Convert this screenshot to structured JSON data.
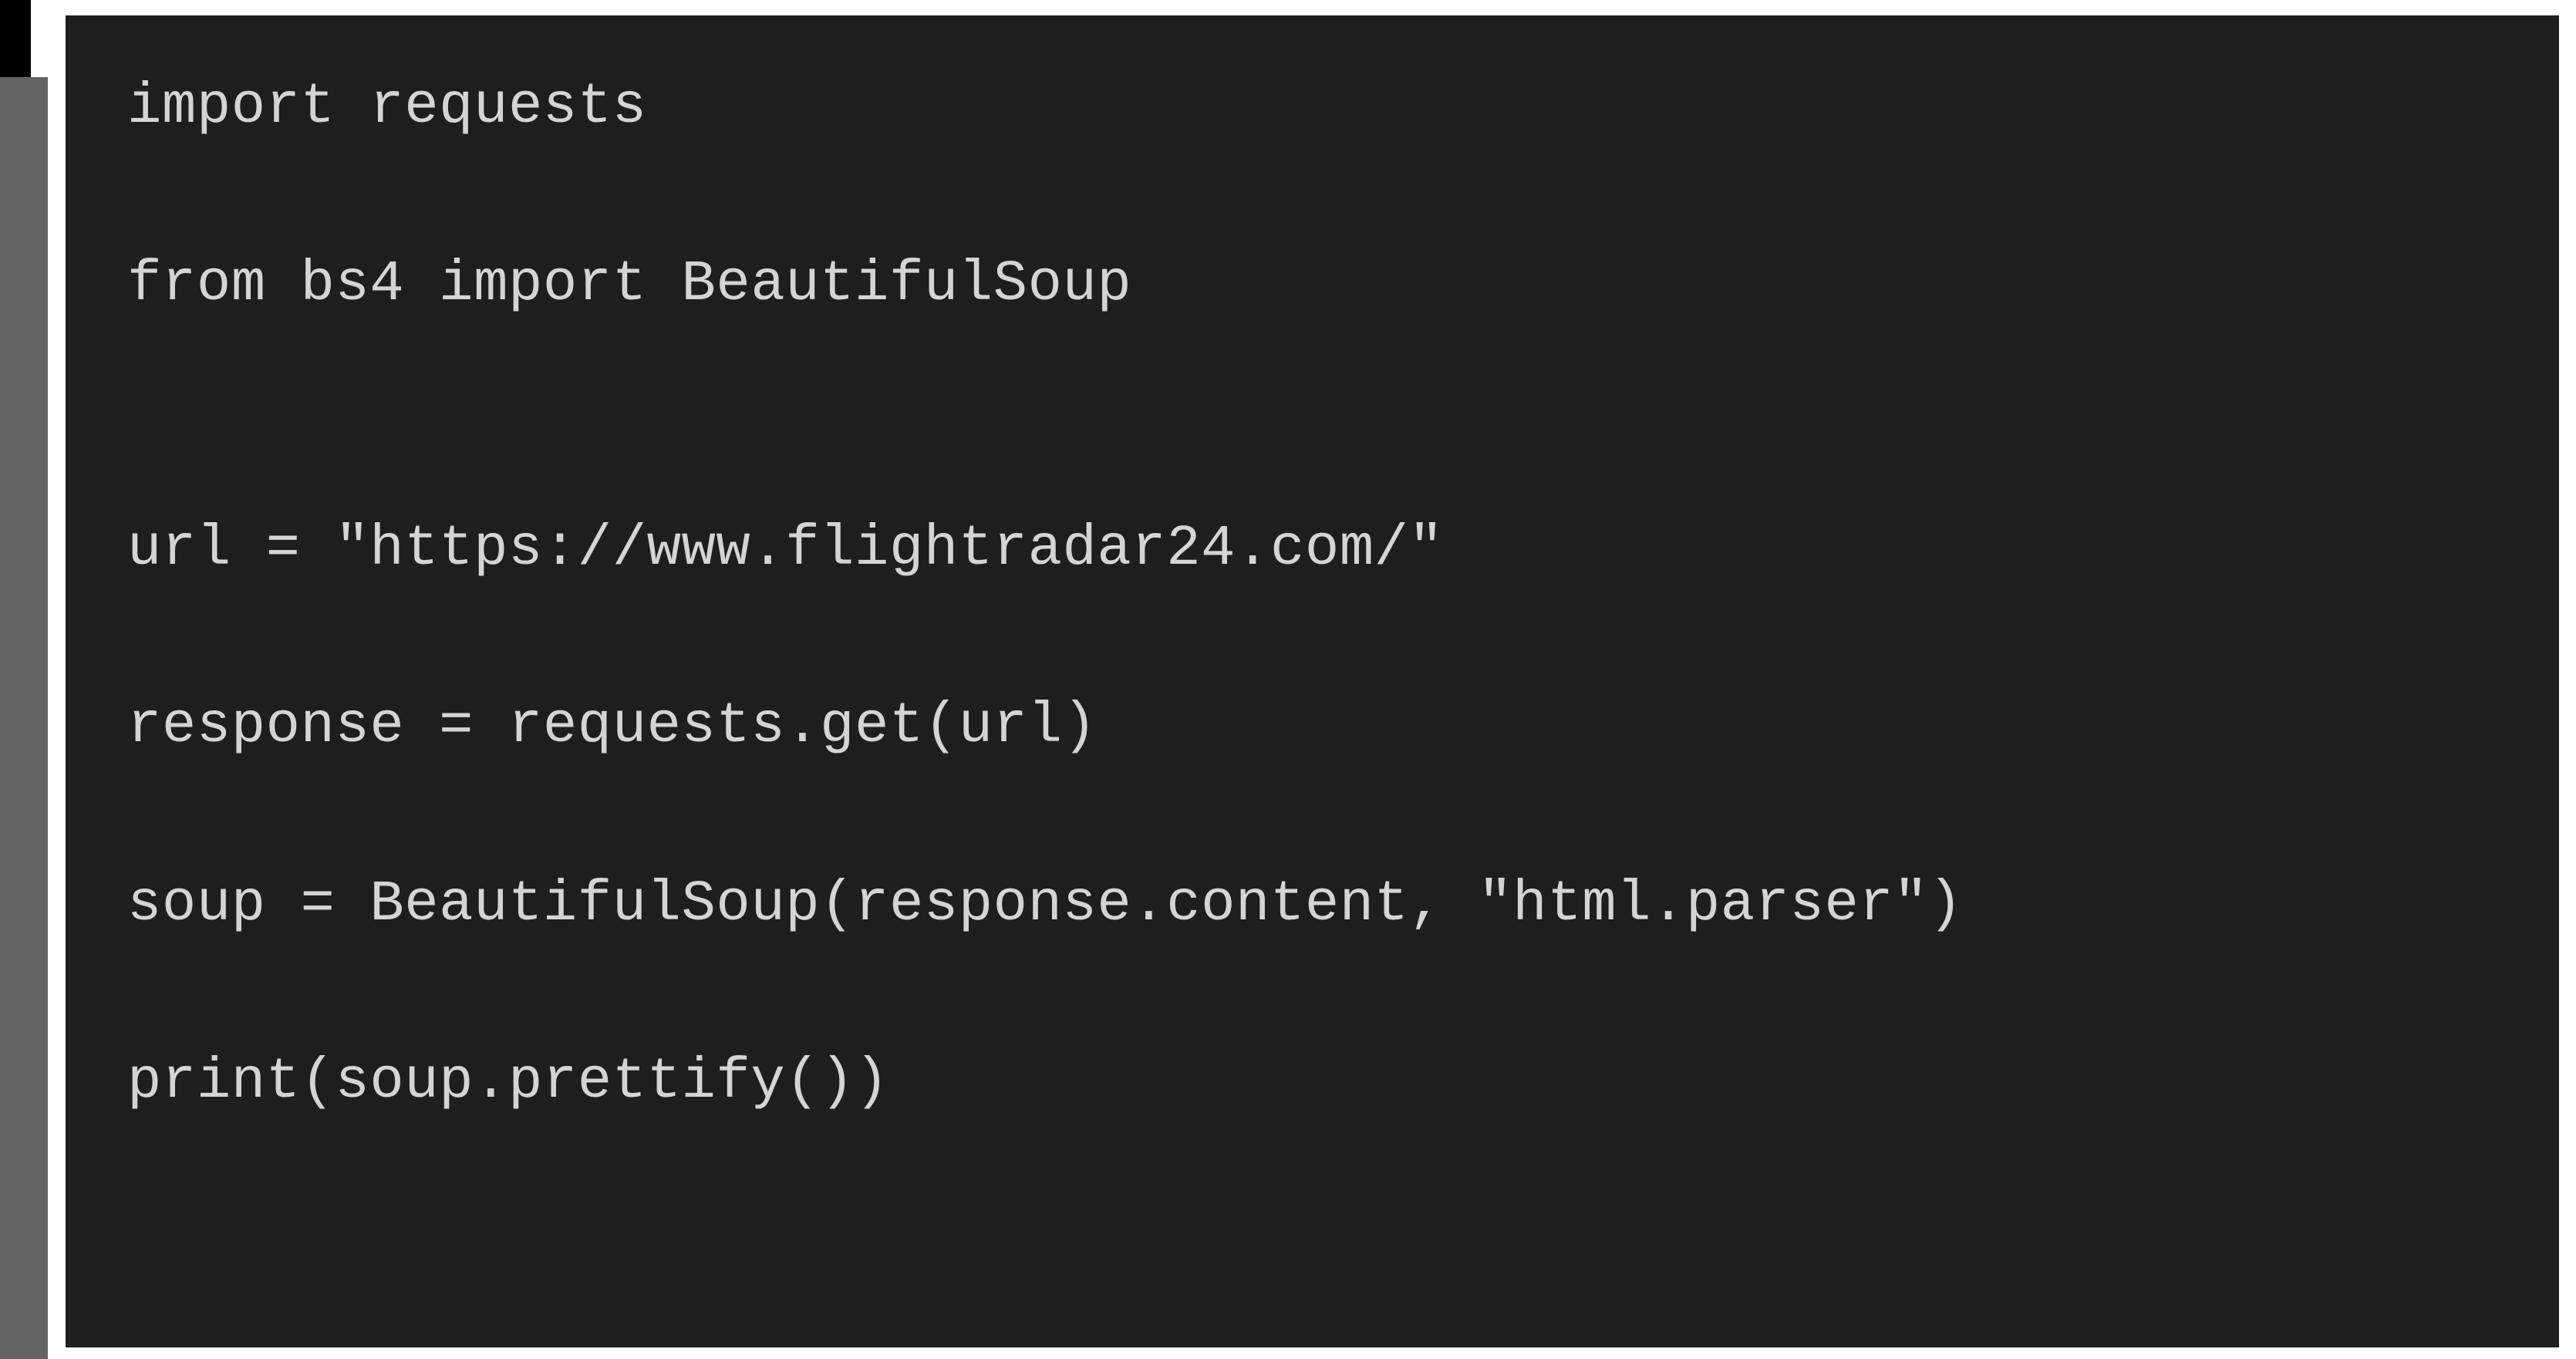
{
  "code": {
    "lines": [
      "import requests",
      "from bs4 import BeautifulSoup",
      "",
      "url = \"https://www.flightradar24.com/\"",
      "response = requests.get(url)",
      "soup = BeautifulSoup(response.content, \"html.parser\")",
      "print(soup.prettify())"
    ]
  }
}
